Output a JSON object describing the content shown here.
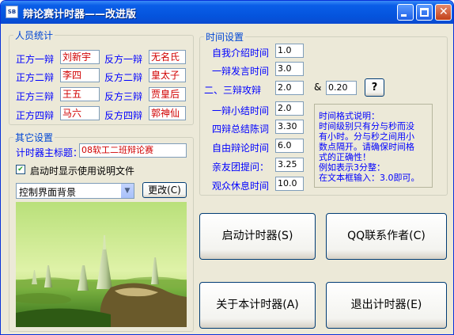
{
  "window": {
    "title": "辩论赛计时器——改进版",
    "icon_text": "SB"
  },
  "personnel": {
    "legend": "人员统计",
    "rows": [
      {
        "pro_label": "正方一辩",
        "pro_name": "刘新宇",
        "con_label": "反方一辩",
        "con_name": "无名氏"
      },
      {
        "pro_label": "正方二辩",
        "pro_name": "李四",
        "con_label": "反方二辩",
        "con_name": "皇太子"
      },
      {
        "pro_label": "正方三辩",
        "pro_name": "王五",
        "con_label": "反方三辩",
        "con_name": "贾皇后"
      },
      {
        "pro_label": "正方四辩",
        "pro_name": "马六",
        "con_label": "反方四辩",
        "con_name": "郭神仙"
      }
    ]
  },
  "other": {
    "legend": "其它设置",
    "title_label": "计时器主标题：",
    "title_value": "08软工二班辩论赛",
    "checkbox_label": "启动时显示使用说明文件",
    "checkbox_checked": true,
    "combo_value": "控制界面背景",
    "change_button": "更改(C)"
  },
  "time": {
    "legend": "时间设置",
    "rows": [
      {
        "label": "自我介绍时间",
        "value": "1.0"
      },
      {
        "label": "一辩发言时间",
        "value": "3.0"
      },
      {
        "label": "二、三辩攻辩",
        "value": "2.0",
        "amp": "&",
        "extra": "0.20",
        "help": "?"
      },
      {
        "label": "一辩小结时间",
        "value": "2.0"
      },
      {
        "label": "四辩总结陈词",
        "value": "3.30"
      },
      {
        "label": "自由辩论时间",
        "value": "6.0"
      },
      {
        "label": "亲友团提问：",
        "value": "3.25"
      },
      {
        "label": "观众休息时间",
        "value": "10.0"
      }
    ],
    "note_lines": [
      "时间格式说明：",
      "时间级别只有分与秒而没",
      "有小时。分与秒之间用小",
      "数点隔开。请确保时间格",
      "式的正确性！",
      "例如表示3分整：",
      "在文本框输入：3.0即可。"
    ]
  },
  "buttons": {
    "start": "启动计时器(S)",
    "contact": "QQ联系作者(C)",
    "about": "关于本计时器(A)",
    "exit": "退出计时器(E)"
  },
  "colors": {
    "legend": "#0046d5",
    "blue_label": "#0000ff",
    "red_text": "#d00000",
    "window_bg": "#ece9d8",
    "titlebar": "#0453dc"
  },
  "icons": {
    "app": "app-icon",
    "minimize": "minimize-icon",
    "maximize": "maximize-icon",
    "close": "close-icon",
    "combo": "chevron-down-icon",
    "check": "checkmark-icon"
  }
}
